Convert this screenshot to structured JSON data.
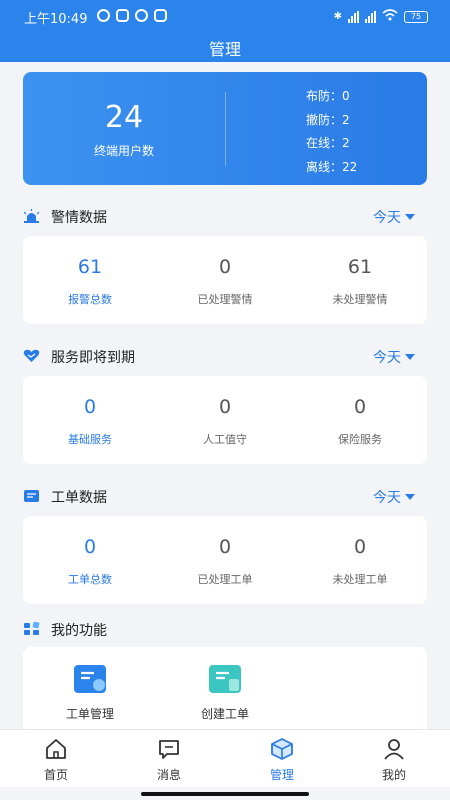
{
  "status_bar": {
    "time": "上午10:49",
    "battery": "75"
  },
  "header": {
    "title": "管理"
  },
  "summary": {
    "count": "24",
    "label": "终端用户数",
    "stats": [
      "布防：0",
      "撤防：2",
      "在线：2",
      "离线：22"
    ]
  },
  "sections": [
    {
      "title": "警情数据",
      "filter": "今天",
      "icon": "alarm-light-icon",
      "items": [
        {
          "value": "61",
          "label": "报警总数"
        },
        {
          "value": "0",
          "label": "已处理警情"
        },
        {
          "value": "61",
          "label": "未处理警情"
        }
      ]
    },
    {
      "title": "服务即将到期",
      "filter": "今天",
      "icon": "heart-handshake-icon",
      "items": [
        {
          "value": "0",
          "label": "基础服务"
        },
        {
          "value": "0",
          "label": "人工值守"
        },
        {
          "value": "0",
          "label": "保险服务"
        }
      ]
    },
    {
      "title": "工单数据",
      "filter": "今天",
      "icon": "ticket-icon",
      "items": [
        {
          "value": "0",
          "label": "工单总数"
        },
        {
          "value": "0",
          "label": "已处理工单"
        },
        {
          "value": "0",
          "label": "未处理工单"
        }
      ]
    }
  ],
  "functions": {
    "title": "我的功能",
    "items": [
      {
        "label": "工单管理",
        "icon": "ticket-manage-icon"
      },
      {
        "label": "创建工单",
        "icon": "create-ticket-icon"
      }
    ]
  },
  "tabbar": [
    {
      "label": "首页",
      "icon": "home-icon"
    },
    {
      "label": "消息",
      "icon": "message-icon"
    },
    {
      "label": "管理",
      "icon": "box-icon",
      "active": true
    },
    {
      "label": "我的",
      "icon": "user-icon"
    }
  ],
  "colors": {
    "primary": "#2a7be6",
    "background": "#f2f4f8"
  }
}
